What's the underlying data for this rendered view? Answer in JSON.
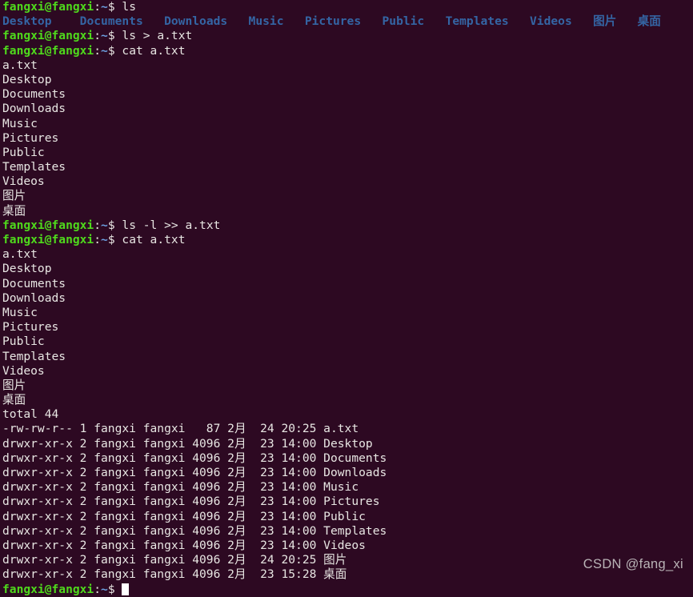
{
  "terminal": {
    "colors": {
      "background": "#2d0922",
      "foreground": "#e8e6e3",
      "prompt_user": "#4fd91c",
      "prompt_path": "#6b9fe0",
      "directory": "#3465a4",
      "cursor": "#ffffff",
      "watermark": "#b9b3b6"
    },
    "prompt": {
      "user_host": "fangxi@fangxi",
      "colon": ":",
      "path": "~",
      "sigil": "$"
    },
    "lines": [
      {
        "type": "prompt",
        "command": " ls"
      },
      {
        "type": "dirlist",
        "entries": "Desktop    Documents   Downloads   Music   Pictures   Public   Templates   Videos   图片   桌面"
      },
      {
        "type": "prompt",
        "command": " ls > a.txt"
      },
      {
        "type": "prompt",
        "command": " cat a.txt"
      },
      {
        "type": "output",
        "text": "a.txt"
      },
      {
        "type": "output",
        "text": "Desktop"
      },
      {
        "type": "output",
        "text": "Documents"
      },
      {
        "type": "output",
        "text": "Downloads"
      },
      {
        "type": "output",
        "text": "Music"
      },
      {
        "type": "output",
        "text": "Pictures"
      },
      {
        "type": "output",
        "text": "Public"
      },
      {
        "type": "output",
        "text": "Templates"
      },
      {
        "type": "output",
        "text": "Videos"
      },
      {
        "type": "output",
        "text": "图片"
      },
      {
        "type": "output",
        "text": "桌面"
      },
      {
        "type": "prompt",
        "command": " ls -l >> a.txt"
      },
      {
        "type": "prompt",
        "command": " cat a.txt"
      },
      {
        "type": "output",
        "text": "a.txt"
      },
      {
        "type": "output",
        "text": "Desktop"
      },
      {
        "type": "output",
        "text": "Documents"
      },
      {
        "type": "output",
        "text": "Downloads"
      },
      {
        "type": "output",
        "text": "Music"
      },
      {
        "type": "output",
        "text": "Pictures"
      },
      {
        "type": "output",
        "text": "Public"
      },
      {
        "type": "output",
        "text": "Templates"
      },
      {
        "type": "output",
        "text": "Videos"
      },
      {
        "type": "output",
        "text": "图片"
      },
      {
        "type": "output",
        "text": "桌面"
      },
      {
        "type": "output",
        "text": "total 44"
      },
      {
        "type": "output",
        "text": "-rw-rw-r-- 1 fangxi fangxi   87 2月  24 20:25 a.txt"
      },
      {
        "type": "output",
        "text": "drwxr-xr-x 2 fangxi fangxi 4096 2月  23 14:00 Desktop"
      },
      {
        "type": "output",
        "text": "drwxr-xr-x 2 fangxi fangxi 4096 2月  23 14:00 Documents"
      },
      {
        "type": "output",
        "text": "drwxr-xr-x 2 fangxi fangxi 4096 2月  23 14:00 Downloads"
      },
      {
        "type": "output",
        "text": "drwxr-xr-x 2 fangxi fangxi 4096 2月  23 14:00 Music"
      },
      {
        "type": "output",
        "text": "drwxr-xr-x 2 fangxi fangxi 4096 2月  23 14:00 Pictures"
      },
      {
        "type": "output",
        "text": "drwxr-xr-x 2 fangxi fangxi 4096 2月  23 14:00 Public"
      },
      {
        "type": "output",
        "text": "drwxr-xr-x 2 fangxi fangxi 4096 2月  23 14:00 Templates"
      },
      {
        "type": "output",
        "text": "drwxr-xr-x 2 fangxi fangxi 4096 2月  23 14:00 Videos"
      },
      {
        "type": "output",
        "text": "drwxr-xr-x 2 fangxi fangxi 4096 2月  24 20:25 图片"
      },
      {
        "type": "output",
        "text": "drwxr-xr-x 2 fangxi fangxi 4096 2月  23 15:28 桌面"
      },
      {
        "type": "prompt-cursor",
        "command": " "
      }
    ],
    "dir_entries": [
      "Desktop",
      "Documents",
      "Downloads",
      "Music",
      "Pictures",
      "Public",
      "Templates",
      "Videos",
      "图片",
      "桌面"
    ],
    "listing": {
      "total": "total 44",
      "columns": [
        "permissions",
        "links",
        "owner",
        "group",
        "size",
        "month",
        "day",
        "time",
        "name"
      ],
      "rows": [
        {
          "permissions": "-rw-rw-r--",
          "links": "1",
          "owner": "fangxi",
          "group": "fangxi",
          "size": "87",
          "month": "2月",
          "day": "24",
          "time": "20:25",
          "name": "a.txt"
        },
        {
          "permissions": "drwxr-xr-x",
          "links": "2",
          "owner": "fangxi",
          "group": "fangxi",
          "size": "4096",
          "month": "2月",
          "day": "23",
          "time": "14:00",
          "name": "Desktop"
        },
        {
          "permissions": "drwxr-xr-x",
          "links": "2",
          "owner": "fangxi",
          "group": "fangxi",
          "size": "4096",
          "month": "2月",
          "day": "23",
          "time": "14:00",
          "name": "Documents"
        },
        {
          "permissions": "drwxr-xr-x",
          "links": "2",
          "owner": "fangxi",
          "group": "fangxi",
          "size": "4096",
          "month": "2月",
          "day": "23",
          "time": "14:00",
          "name": "Downloads"
        },
        {
          "permissions": "drwxr-xr-x",
          "links": "2",
          "owner": "fangxi",
          "group": "fangxi",
          "size": "4096",
          "month": "2月",
          "day": "23",
          "time": "14:00",
          "name": "Music"
        },
        {
          "permissions": "drwxr-xr-x",
          "links": "2",
          "owner": "fangxi",
          "group": "fangxi",
          "size": "4096",
          "month": "2月",
          "day": "23",
          "time": "14:00",
          "name": "Pictures"
        },
        {
          "permissions": "drwxr-xr-x",
          "links": "2",
          "owner": "fangxi",
          "group": "fangxi",
          "size": "4096",
          "month": "2月",
          "day": "23",
          "time": "14:00",
          "name": "Public"
        },
        {
          "permissions": "drwxr-xr-x",
          "links": "2",
          "owner": "fangxi",
          "group": "fangxi",
          "size": "4096",
          "month": "2月",
          "day": "23",
          "time": "14:00",
          "name": "Templates"
        },
        {
          "permissions": "drwxr-xr-x",
          "links": "2",
          "owner": "fangxi",
          "group": "fangxi",
          "size": "4096",
          "month": "2月",
          "day": "23",
          "time": "14:00",
          "name": "Videos"
        },
        {
          "permissions": "drwxr-xr-x",
          "links": "2",
          "owner": "fangxi",
          "group": "fangxi",
          "size": "4096",
          "month": "2月",
          "day": "24",
          "time": "20:25",
          "name": "图片"
        },
        {
          "permissions": "drwxr-xr-x",
          "links": "2",
          "owner": "fangxi",
          "group": "fangxi",
          "size": "4096",
          "month": "2月",
          "day": "23",
          "time": "15:28",
          "name": "桌面"
        }
      ]
    }
  },
  "watermark": {
    "text": "CSDN @fang_xi"
  }
}
